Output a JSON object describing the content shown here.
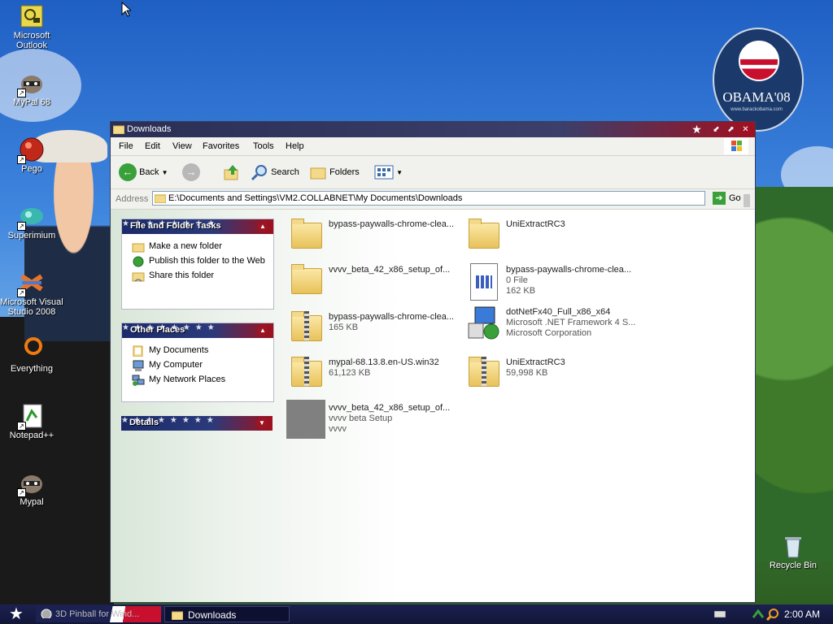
{
  "desktop": {
    "icons": [
      {
        "label": "Microsoft Outlook",
        "icon": "outlook-icon"
      },
      {
        "label": "MyPal 68",
        "icon": "raccoon-icon"
      },
      {
        "label": "Pego",
        "icon": "pego-icon"
      },
      {
        "label": "Superimium",
        "icon": "superimium-icon"
      },
      {
        "label": "Microsoft Visual Studio 2008",
        "icon": "visual-studio-icon"
      },
      {
        "label": "Everything",
        "icon": "everything-icon"
      },
      {
        "label": "Notepad++",
        "icon": "notepad-icon"
      },
      {
        "label": "Mypal",
        "icon": "raccoon-icon"
      },
      {
        "label": "Recycle Bin",
        "icon": "recycle-bin-icon"
      }
    ],
    "wallpaper_logo": {
      "title": "OBAMA'08",
      "sub": "www.barackobama.com"
    }
  },
  "window": {
    "title": "Downloads",
    "menu": [
      "File",
      "Edit",
      "View",
      "Favorites",
      "Tools",
      "Help"
    ],
    "toolbar": {
      "back": "Back",
      "search": "Search",
      "folders": "Folders"
    },
    "address": {
      "label": "Address",
      "value": "E:\\Documents and Settings\\VM2.COLLABNET\\My Documents\\Downloads",
      "go": "Go"
    },
    "tasks": {
      "title": "File and Folder Tasks",
      "items": [
        "Make a new folder",
        "Publish this folder to the Web",
        "Share this folder"
      ]
    },
    "other_places": {
      "title": "Other Places",
      "items": [
        "My Documents",
        "My Computer",
        "My Network Places"
      ]
    },
    "details": {
      "title": "Details"
    },
    "files": [
      {
        "name": "bypass-paywalls-chrome-clea...",
        "l1": "",
        "l2": "",
        "type": "folder"
      },
      {
        "name": "UniExtractRC3",
        "l1": "",
        "l2": "",
        "type": "folder"
      },
      {
        "name": "vvvv_beta_42_x86_setup_of...",
        "l1": "",
        "l2": "",
        "type": "folder"
      },
      {
        "name": "bypass-paywalls-chrome-clea...",
        "l1": "0 File",
        "l2": "162 KB",
        "type": "doc"
      },
      {
        "name": "bypass-paywalls-chrome-clea...",
        "l1": "165 KB",
        "l2": "",
        "type": "zip"
      },
      {
        "name": "dotNetFx40_Full_x86_x64",
        "l1": "Microsoft .NET Framework 4 S...",
        "l2": "Microsoft Corporation",
        "type": "setup"
      },
      {
        "name": "mypal-68.13.8.en-US.win32",
        "l1": "61,123 KB",
        "l2": "",
        "type": "zip"
      },
      {
        "name": "UniExtractRC3",
        "l1": "59,998 KB",
        "l2": "",
        "type": "zip"
      },
      {
        "name": "vvvv_beta_42_x86_setup_of...",
        "l1": "vvvv beta Setup",
        "l2": "vvvv",
        "type": "gray"
      }
    ]
  },
  "taskbar": {
    "tasks": [
      {
        "label": "3D Pinball for Wind..."
      },
      {
        "label": "Downloads"
      }
    ],
    "clock": "2:00 AM"
  }
}
